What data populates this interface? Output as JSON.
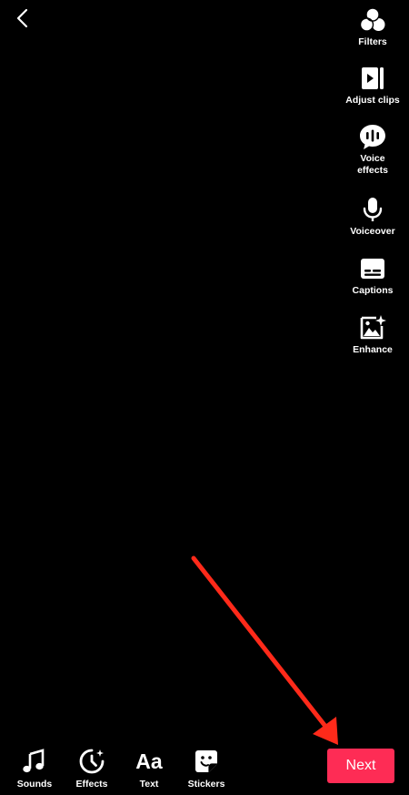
{
  "back": {
    "icon": "chevron-left-icon"
  },
  "right_rail": [
    {
      "key": "filters",
      "label": "Filters",
      "icon": "filters-icon"
    },
    {
      "key": "adjust_clips",
      "label": "Adjust clips",
      "icon": "adjust-clips-icon"
    },
    {
      "key": "voice_effects",
      "label": "Voice\neffects",
      "icon": "voice-effects-icon"
    },
    {
      "key": "voiceover",
      "label": "Voiceover",
      "icon": "microphone-icon"
    },
    {
      "key": "captions",
      "label": "Captions",
      "icon": "captions-icon"
    },
    {
      "key": "enhance",
      "label": "Enhance",
      "icon": "enhance-icon"
    }
  ],
  "bottom_tools": [
    {
      "key": "sounds",
      "label": "Sounds",
      "icon": "music-note-icon"
    },
    {
      "key": "effects",
      "label": "Effects",
      "icon": "effects-icon"
    },
    {
      "key": "text",
      "label": "Text",
      "icon": "text-icon",
      "glyph": "Aa"
    },
    {
      "key": "stickers",
      "label": "Stickers",
      "icon": "stickers-icon"
    }
  ],
  "next_button": {
    "label": "Next",
    "color": "#fe2c55"
  },
  "annotation": {
    "color": "#ff2a1a",
    "points_to": "next-button"
  }
}
